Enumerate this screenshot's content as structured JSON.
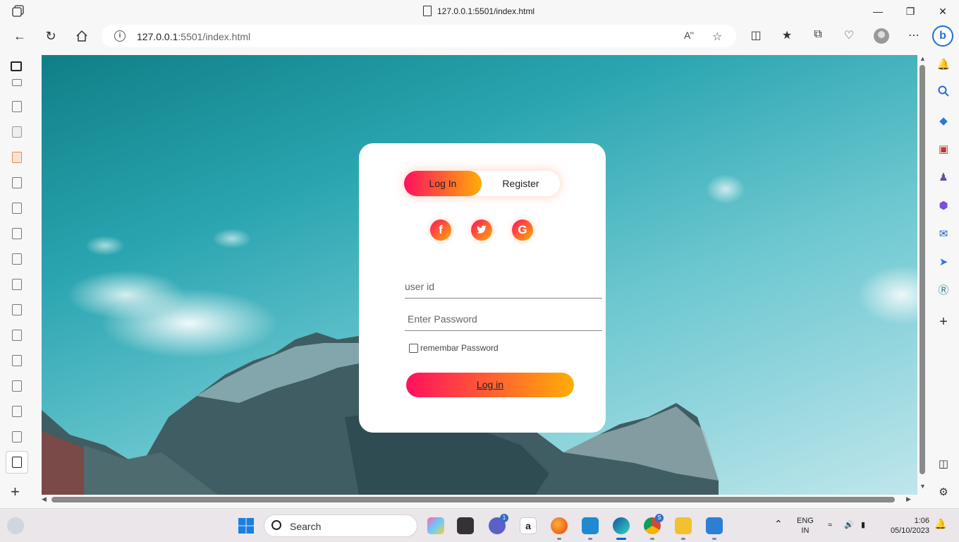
{
  "browser": {
    "tab_title": "127.0.0.1:5501/index.html",
    "url_host": "127.0.0.1",
    "url_rest": ":5501/index.html",
    "read_aloud": "A’’"
  },
  "login": {
    "tab_login": "Log In",
    "tab_register": "Register",
    "social": [
      "f",
      "t",
      "G"
    ],
    "userid_placeholder": "user id",
    "password_placeholder": "Enter Password",
    "remember_label": "remembar Password",
    "submit_label": "Log in",
    "colors": {
      "gradient_start": "#ff105f",
      "gradient_end": "#ffad06"
    }
  },
  "taskbar": {
    "search_label": "Search",
    "teams_badge": "1",
    "chrome_badge": "S",
    "lang_line1": "ENG",
    "lang_line2": "IN",
    "time": "1:06",
    "date": "05/10/2023"
  }
}
